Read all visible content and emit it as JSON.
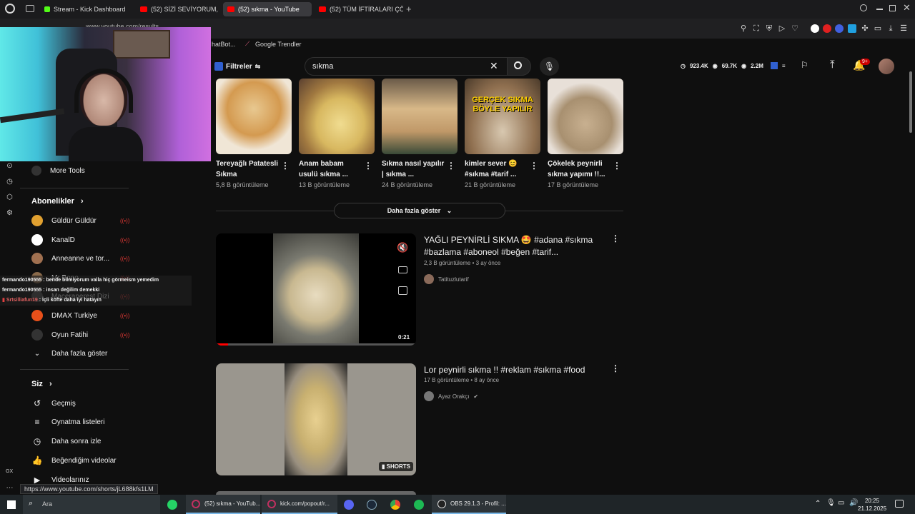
{
  "browser": {
    "tabs": [
      {
        "label": "Stream - Kick Dashboard",
        "icon": "kick-icon",
        "active": false
      },
      {
        "label": "(52) SİZİ SEVİYORUM, SI",
        "icon": "youtube-icon",
        "active": false
      },
      {
        "label": "(52) sıkma - YouTube",
        "icon": "youtube-icon",
        "active": true
      },
      {
        "label": "(52) TÜM İFTİRALARI ÇÖ",
        "icon": "youtube-icon",
        "active": false
      }
    ],
    "address": "www.youtube.com/results",
    "bookmarks": [
      {
        "label": "hatBot...",
        "icon": "bookmark-icon"
      },
      {
        "label": "Google Trendler",
        "icon": "trend-icon"
      }
    ],
    "status_url": "https://www.youtube.com/shorts/jL688kfs1LM",
    "gx_label": "GX"
  },
  "search": {
    "filters_label": "Filtreler",
    "query": "sıkma"
  },
  "header_stats": {
    "subs": "923.4K",
    "views": "69.7K",
    "total": "2.2M",
    "notifications": "9+"
  },
  "sidebar": {
    "more_tools": "More Tools",
    "subscriptions_header": "Abonelikler",
    "subscriptions": [
      {
        "name": "Güldür Güldür",
        "color": "#e0a030"
      },
      {
        "name": "KanalD",
        "color": "#ffffff"
      },
      {
        "name": "Anneanne ve tor...",
        "color": "#a07050"
      },
      {
        "name": "Mr Bono",
        "color": "#8a6a4a"
      },
      {
        "name": "Maceraperest Dizi",
        "color": "#555555"
      },
      {
        "name": "DMAX Turkiye",
        "color": "#e8501a"
      },
      {
        "name": "Oyun Fatihi",
        "color": "#333333"
      }
    ],
    "show_more": "Daha fazla göster",
    "you_header": "Siz",
    "you_items": [
      {
        "label": "Geçmiş",
        "icon": "history-icon"
      },
      {
        "label": "Oynatma listeleri",
        "icon": "playlist-icon"
      },
      {
        "label": "Daha sonra izle",
        "icon": "watch-later-icon"
      },
      {
        "label": "Beğendiğim videolar",
        "icon": "like-icon"
      },
      {
        "label": "Videolarınız",
        "icon": "your-videos-icon"
      }
    ]
  },
  "shorts": [
    {
      "title": "Tereyağlı Patatesli Sıkma",
      "views": "5,8 B görüntüleme"
    },
    {
      "title": "Anam babam usulü sıkma ...",
      "views": "13 B görüntüleme"
    },
    {
      "title": "Sıkma nasıl yapılır | sıkma ...",
      "views": "24 B görüntüleme"
    },
    {
      "title": "kimler sever 😊 #sıkma #tarif ...",
      "views": "21 B görüntüleme",
      "thumb_text": "GERÇEK SIKMA BÖYLE YAPILIR"
    },
    {
      "title": "Çökelek peynirli sıkma yapımı !!...",
      "views": "17 B görüntüleme"
    }
  ],
  "show_more_button": "Daha fazla göster",
  "videos": [
    {
      "title": "YAĞLI PEYNİRLİ SIKMA 🤩 #adana #sıkma #bazlama #aboneol #beğen #tarif...",
      "meta": "2,3 B görüntüleme • 3 ay önce",
      "channel": "Tatituzlutarif",
      "duration": "0:21",
      "progress": 0.06
    },
    {
      "title": "Lor peynirli sıkma !! #reklam #sıkma #food",
      "meta": "17 B görüntüleme • 8 ay önce",
      "channel": "Ayaz Orakçı",
      "badge": "SHORTS"
    }
  ],
  "chat": [
    {
      "user": "fermando190555",
      "text": "bende bilmiyorum valla hiç görmeism yemedim"
    },
    {
      "user": "fermando190555",
      "text": "insan değilim demekki"
    },
    {
      "user": "Srtsilliafun19",
      "text": "İçli köfte daha iyi hatayın"
    }
  ],
  "taskbar": {
    "search_placeholder": "Ara",
    "apps": [
      {
        "label": "(52) sıkma - YouTub...",
        "open": true
      },
      {
        "label": "kick.com/popout/r...",
        "open": true
      },
      {
        "label": "OBS 29.1.3 - Profil: ...",
        "open": true
      }
    ],
    "time": "20:25",
    "date": "21.12.2025"
  }
}
